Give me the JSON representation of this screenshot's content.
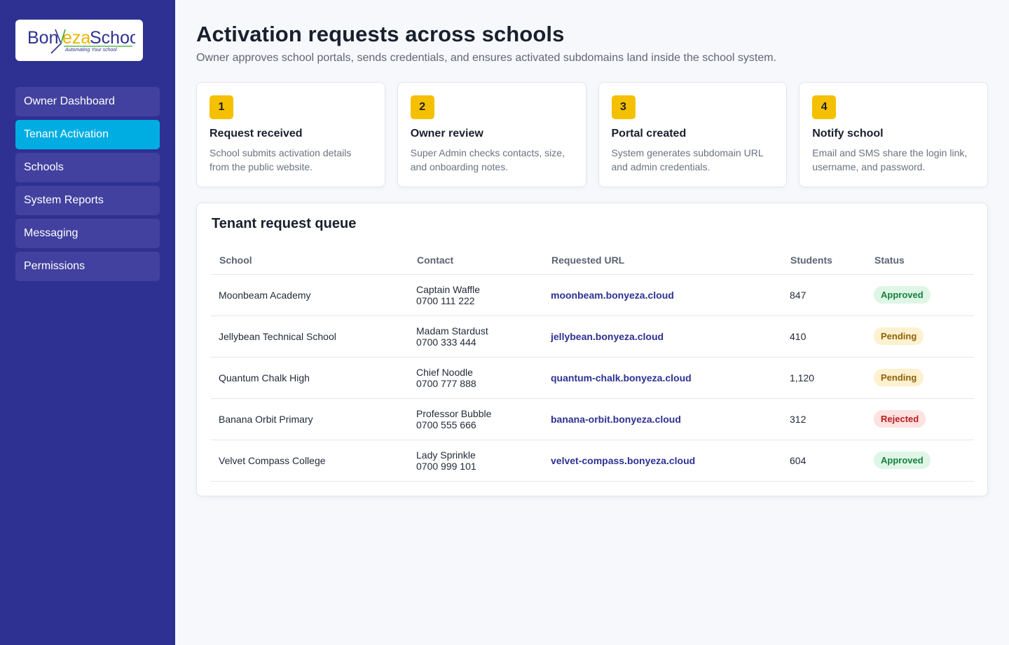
{
  "brand": {
    "logo_text_a": "Bon",
    "logo_text_b": "eza",
    "logo_text_c": "School",
    "logo_tagline": "Automating Your school",
    "colors": {
      "sidebar": "#2e3192",
      "active": "#00ade3",
      "accent": "#f5c000"
    }
  },
  "sidebar": {
    "items": [
      {
        "label": "Owner Dashboard",
        "active": false
      },
      {
        "label": "Tenant Activation",
        "active": true
      },
      {
        "label": "Schools",
        "active": false
      },
      {
        "label": "System Reports",
        "active": false
      },
      {
        "label": "Messaging",
        "active": false
      },
      {
        "label": "Permissions",
        "active": false
      }
    ]
  },
  "header": {
    "title": "Activation requests across schools",
    "subtitle": "Owner approves school portals, sends credentials, and ensures activated subdomains land inside the school system."
  },
  "steps": [
    {
      "num": "1",
      "title": "Request received",
      "desc": "School submits activation details from the public website."
    },
    {
      "num": "2",
      "title": "Owner review",
      "desc": "Super Admin checks contacts, size, and onboarding notes."
    },
    {
      "num": "3",
      "title": "Portal created",
      "desc": "System generates subdomain URL and admin credentials."
    },
    {
      "num": "4",
      "title": "Notify school",
      "desc": "Email and SMS share the login link, username, and password."
    }
  ],
  "queue": {
    "title": "Tenant request queue",
    "columns": [
      "School",
      "Contact",
      "Requested URL",
      "Students",
      "Status"
    ],
    "rows": [
      {
        "school": "Moonbeam Academy",
        "contact_name": "Captain Waffle",
        "contact_phone": "0700 111 222",
        "url": "moonbeam.bonyeza.cloud",
        "students": "847",
        "status": "Approved",
        "status_kind": "approved"
      },
      {
        "school": "Jellybean Technical School",
        "contact_name": "Madam Stardust",
        "contact_phone": "0700 333 444",
        "url": "jellybean.bonyeza.cloud",
        "students": "410",
        "status": "Pending",
        "status_kind": "pending"
      },
      {
        "school": "Quantum Chalk High",
        "contact_name": "Chief Noodle",
        "contact_phone": "0700 777 888",
        "url": "quantum-chalk.bonyeza.cloud",
        "students": "1,120",
        "status": "Pending",
        "status_kind": "pending"
      },
      {
        "school": "Banana Orbit Primary",
        "contact_name": "Professor Bubble",
        "contact_phone": "0700 555 666",
        "url": "banana-orbit.bonyeza.cloud",
        "students": "312",
        "status": "Rejected",
        "status_kind": "rejected"
      },
      {
        "school": "Velvet Compass College",
        "contact_name": "Lady Sprinkle",
        "contact_phone": "0700 999 101",
        "url": "velvet-compass.bonyeza.cloud",
        "students": "604",
        "status": "Approved",
        "status_kind": "approved"
      }
    ]
  }
}
